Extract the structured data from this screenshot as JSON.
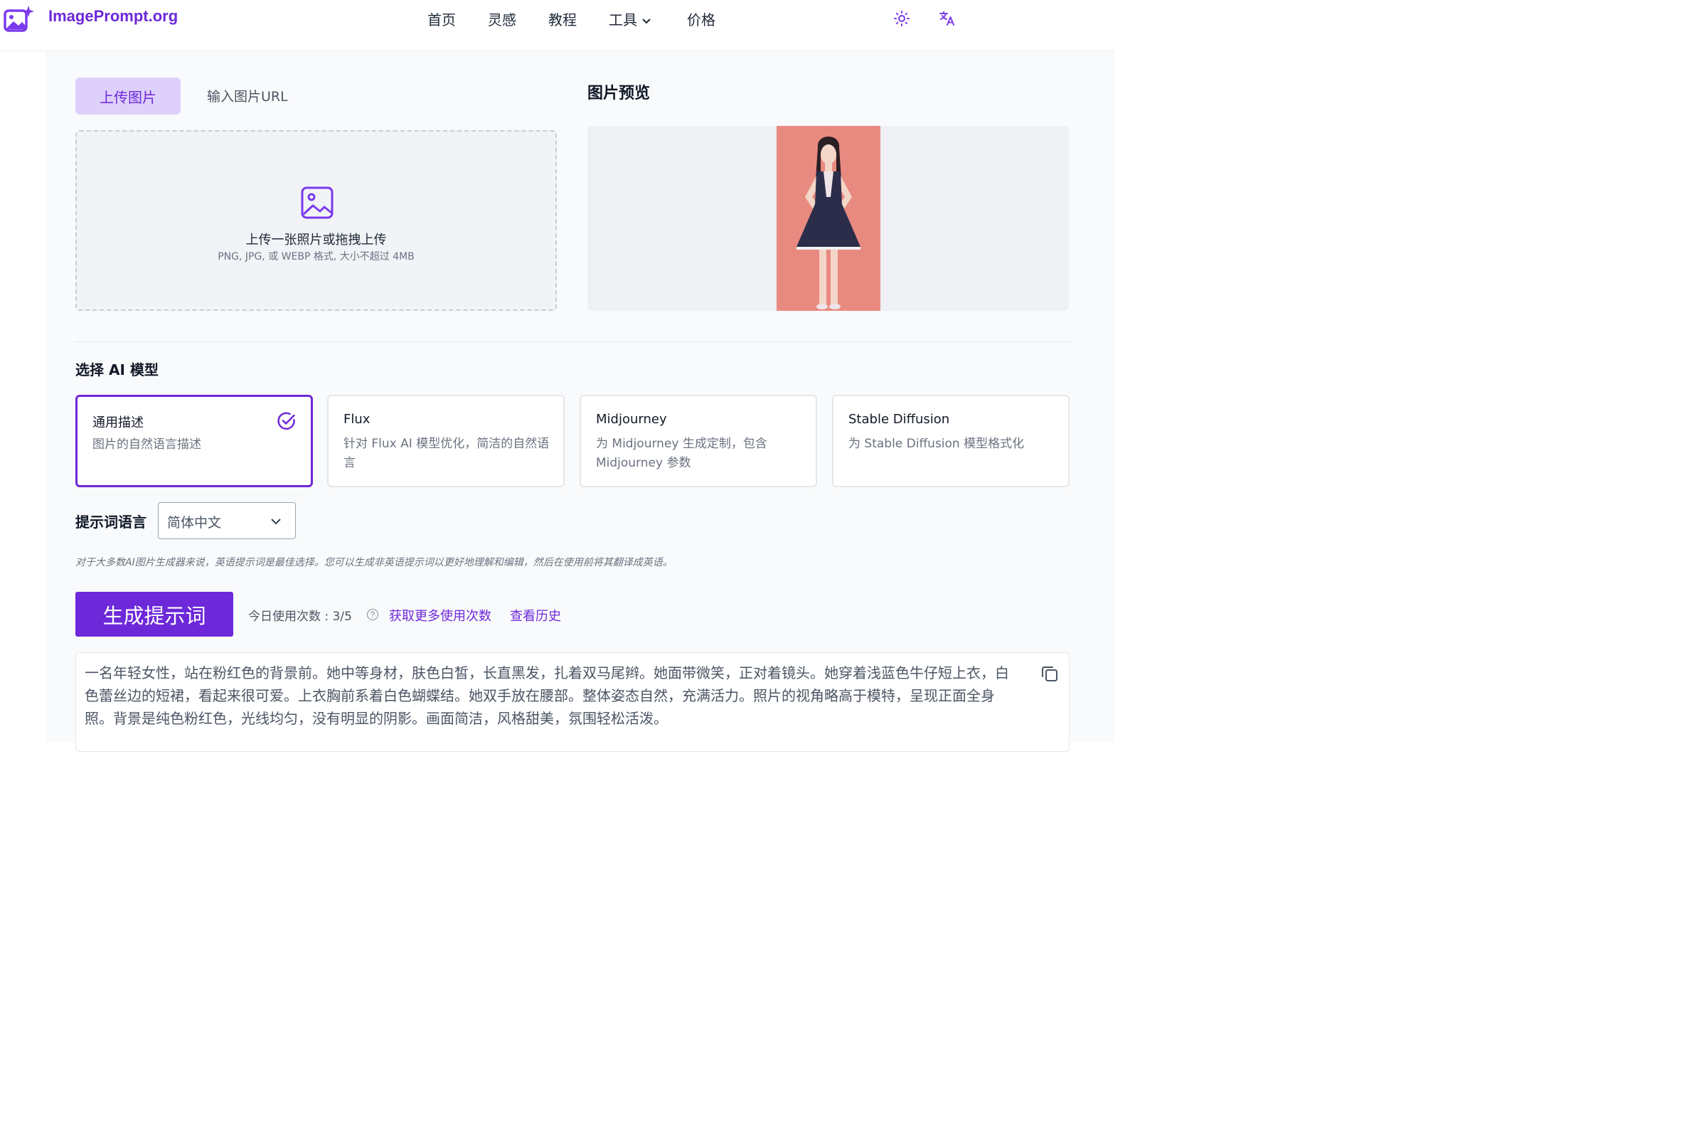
{
  "app": {
    "name": "ImagePrompt.org"
  },
  "nav": {
    "items": [
      "首页",
      "灵感",
      "教程",
      "工具",
      "价格"
    ]
  },
  "upload": {
    "tab_upload": "上传图片",
    "tab_url": "输入图片URL",
    "drop_title": "上传一张照片或拖拽上传",
    "drop_subtitle": "PNG, JPG, 或 WEBP 格式, 大小不超过 4MB"
  },
  "preview": {
    "title": "图片预览"
  },
  "models": {
    "label": "选择 AI 模型",
    "items": [
      {
        "name": "通用描述",
        "desc": "图片的自然语言描述",
        "selected": true
      },
      {
        "name": "Flux",
        "desc": "针对 Flux AI 模型优化，简洁的自然语言",
        "selected": false
      },
      {
        "name": "Midjourney",
        "desc": "为 Midjourney 生成定制，包含 Midjourney 参数",
        "selected": false
      },
      {
        "name": "Stable Diffusion",
        "desc": "为 Stable Diffusion 模型格式化",
        "selected": false
      }
    ]
  },
  "language": {
    "label": "提示词语言",
    "value": "简体中文"
  },
  "hint": "对于大多数AI图片生成器来说，英语提示词是最佳选择。您可以生成非英语提示词以更好地理解和编辑，然后在使用前将其翻译成英语。",
  "generate": {
    "button": "生成提示词",
    "usage": "今日使用次数 : 3/5",
    "more_link": "获取更多使用次数",
    "history_link": "查看历史"
  },
  "result": {
    "text": "一名年轻女性，站在粉红色的背景前。她中等身材，肤色白皙，长直黑发，扎着双马尾辫。她面带微笑，正对着镜头。她穿着浅蓝色牛仔短上衣，白色蕾丝边的短裙，看起来很可爱。上衣胸前系着白色蝴蝶结。她双手放在腰部。整体姿态自然，充满活力。照片的视角略高于模特，呈现正面全身照。背景是纯色粉红色，光线均匀，没有明显的阴影。画面简洁，风格甜美，氛围轻松活泼。"
  },
  "colors": {
    "accent": "#6d28d9",
    "accent_light": "#ddd0fb",
    "preview_bg": "#e98a80"
  },
  "icons": [
    "logo-image-sparkle-icon",
    "chevron-down-icon",
    "sun-icon",
    "translate-icon",
    "image-upload-icon",
    "check-circle-icon",
    "help-circle-icon",
    "copy-icon"
  ]
}
